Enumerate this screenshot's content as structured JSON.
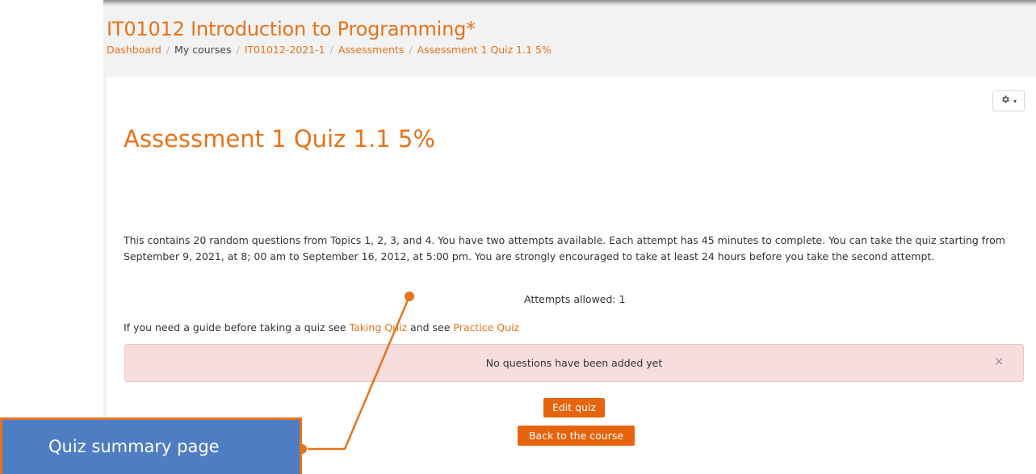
{
  "header": {
    "course_title": "IT01012 Introduction to Programming*",
    "breadcrumb": [
      "Dashboard",
      "My courses",
      "IT01012-2021-1",
      "Assessments",
      "Assessment 1 Quiz 1.1 5%"
    ],
    "separator": "/"
  },
  "settings": {
    "icon": "gear-icon",
    "caret": "▾"
  },
  "quiz": {
    "title": "Assessment 1 Quiz 1.1 5%",
    "intro": "This contains 20 random questions from Topics 1, 2, 3, and 4. You have two attempts available. Each attempt has  45 minutes to complete. You can take the quiz starting from September 9, 2021, at 8; 00 am to September 16, 2012, at 5:00 pm. You are strongly encouraged to take at least 24 hours before you take the second attempt.",
    "guide_prefix": "If you need a guide before taking a quiz see",
    "guide_link1": "Taking Quiz",
    "guide_middle": "and see",
    "guide_link2": "Practice Quiz",
    "attempts_allowed": "Attempts allowed: 1"
  },
  "alert": {
    "message": "No questions have been added yet",
    "close": "×"
  },
  "buttons": {
    "edit_quiz": "Edit quiz",
    "back_to_course": "Back to the course"
  },
  "annotation": {
    "label": "Quiz summary page"
  },
  "colors": {
    "accent": "#e8731a",
    "button": "#e8640c",
    "alert_bg": "#f7dddd",
    "annotation_bg": "#4f7dc3"
  }
}
